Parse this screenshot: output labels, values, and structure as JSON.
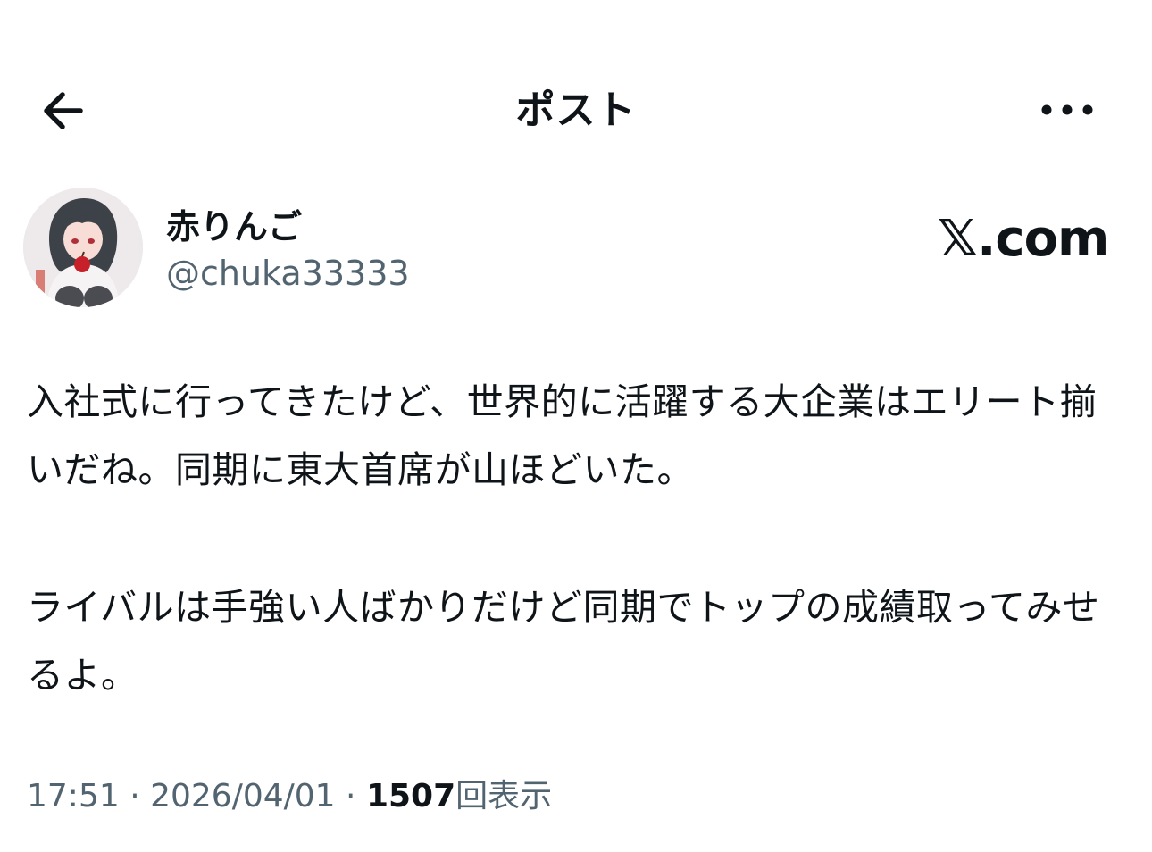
{
  "header": {
    "title": "ポスト",
    "back_icon": "arrow-left-icon",
    "more_icon": "more-horizontal-icon"
  },
  "author": {
    "display_name": "赤りんご",
    "handle": "@chuka33333",
    "avatar": "anime-girl-avatar"
  },
  "watermark": {
    "text": "𝕏.com"
  },
  "post": {
    "paragraphs": [
      "入社式に行ってきたけど、世界的に活躍する大企業はエリート揃いだね。同期に東大首席が山ほどいた。",
      "ライバルは手強い人ばかりだけど同期でトップの成績取ってみせるよ。"
    ]
  },
  "meta": {
    "time": "17:51",
    "separator": " · ",
    "date": "2026/04/01",
    "views_count": "1507",
    "views_label": "回表示"
  },
  "colors": {
    "text": "#0f1419",
    "secondary": "#536471",
    "background": "#ffffff"
  }
}
